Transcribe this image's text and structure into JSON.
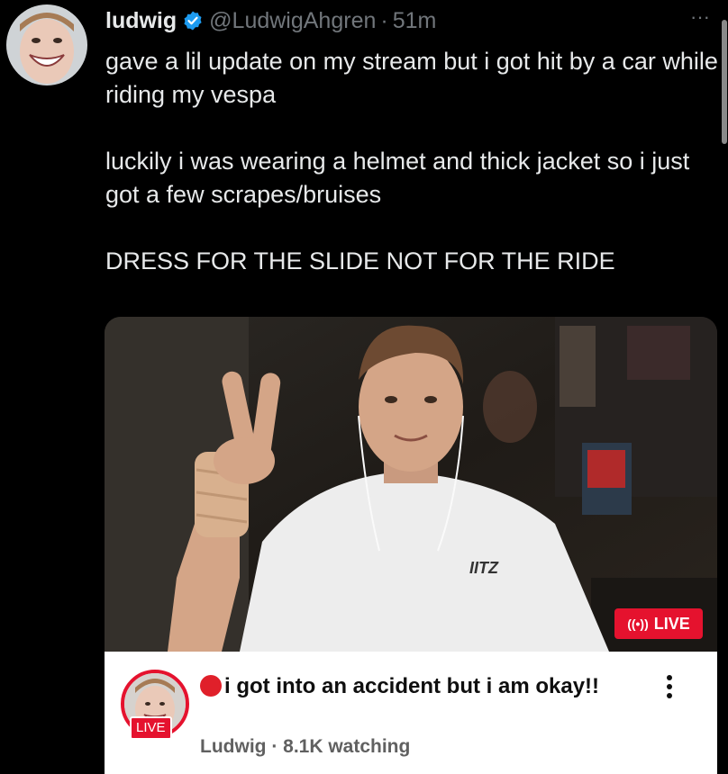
{
  "tweet": {
    "author_name": "ludwig",
    "handle": "@LudwigAhgren",
    "separator": "·",
    "time": "51m",
    "more_label": "···",
    "text": [
      "gave a lil update on my stream but i got hit by a car while riding my vespa",
      "luckily i was wearing a helmet and thick jacket so i just got a few scrapes/bruises",
      "DRESS FOR THE SLIDE NOT FOR THE RIDE"
    ]
  },
  "stream_preview": {
    "live_badge": "LIVE",
    "live_badge_icon": "broadcast-icon",
    "shirt_text": "IITZ",
    "channel_live_label": "LIVE",
    "title": "i got into an accident but i am okay!!",
    "meta": "Ludwig · 8.1K watching",
    "menu_label": "⋮"
  },
  "colors": {
    "background": "#000000",
    "text": "#e7e9ea",
    "muted": "#71767b",
    "verified": "#1d9bf0",
    "live_red": "#e5122e"
  }
}
